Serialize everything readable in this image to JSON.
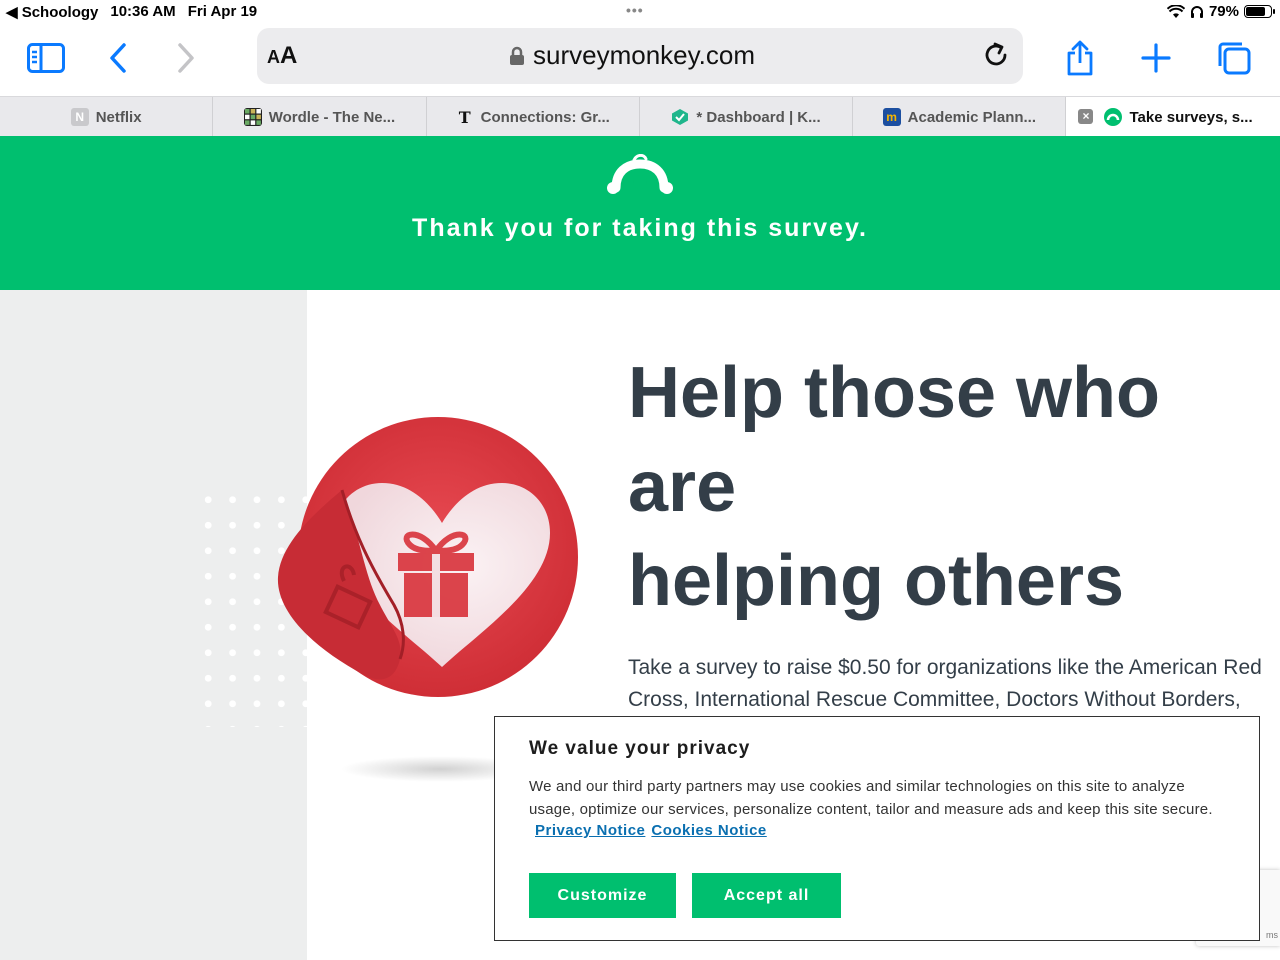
{
  "status_bar": {
    "back_app": "◀ Schoology",
    "time": "10:36 AM",
    "date": "Fri Apr 19",
    "battery": "79%",
    "battery_level": 0.79
  },
  "toolbar": {
    "text_size": "AA",
    "url": "surveymonkey.com"
  },
  "tabs": [
    {
      "label": "Netflix",
      "icon": "netflix-icon"
    },
    {
      "label": "Wordle - The Ne...",
      "icon": "wordle-icon"
    },
    {
      "label": "Connections: Gr...",
      "icon": "nyt-icon"
    },
    {
      "label": "* Dashboard | K...",
      "icon": "kami-icon"
    },
    {
      "label": "Academic Plann...",
      "icon": "planner-icon"
    },
    {
      "label": "Take surveys, s...",
      "icon": "surveymonkey-icon",
      "active": true
    }
  ],
  "header": {
    "thanks": "Thank you for taking this survey."
  },
  "main": {
    "headline_1": "Help those who",
    "headline_2": "are",
    "headline_3": "helping others",
    "body": "Take a survey to raise $0.50 for organizations like the American Red Cross, International Rescue Committee, Doctors Without Borders,"
  },
  "privacy": {
    "title": "We value your privacy",
    "description": "We and our third party partners may use cookies and similar technologies on this site to analyze usage, optimize our services, personalize content, tailor and measure ads and keep this site secure.",
    "privacy_link": "Privacy Notice",
    "cookies_link": "Cookies Notice",
    "customize_label": "Customize",
    "accept_label": "Accept all"
  },
  "recaptcha": {
    "text": "ms"
  },
  "colors": {
    "brand_green": "#00bf6f",
    "text_dark": "#333e48",
    "ios_blue": "#0a7aff",
    "heart_red": "#d9363e",
    "link_blue": "#0a6fb0"
  }
}
